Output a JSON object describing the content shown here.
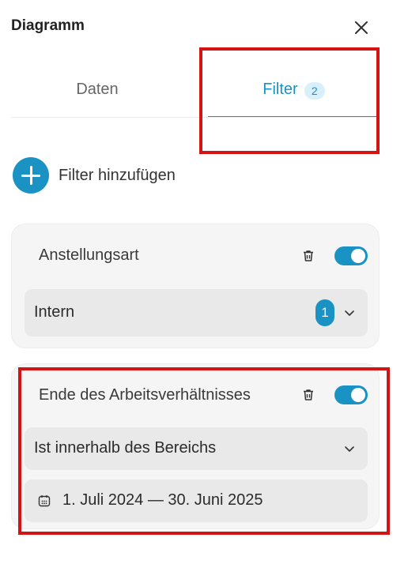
{
  "panel": {
    "title": "Diagramm"
  },
  "tabs": {
    "daten": {
      "label": "Daten"
    },
    "filter": {
      "label": "Filter",
      "badge": "2"
    }
  },
  "add_filter": {
    "label": "Filter hinzufügen"
  },
  "filters": [
    {
      "title": "Anstellungsart",
      "enabled": true,
      "value": "Intern",
      "count": "1"
    },
    {
      "title": "Ende des Arbeitsverhältnisses",
      "enabled": true,
      "operator": "Ist innerhalb des Bereichs",
      "date_range": "1. Juli 2024 — 30. Juni 2025"
    }
  ],
  "colors": {
    "accent": "#1a92c3",
    "highlight": "#d31414"
  },
  "icons": [
    "close-icon",
    "plus-icon",
    "trash-icon",
    "chevron-down-icon",
    "calendar-icon"
  ]
}
